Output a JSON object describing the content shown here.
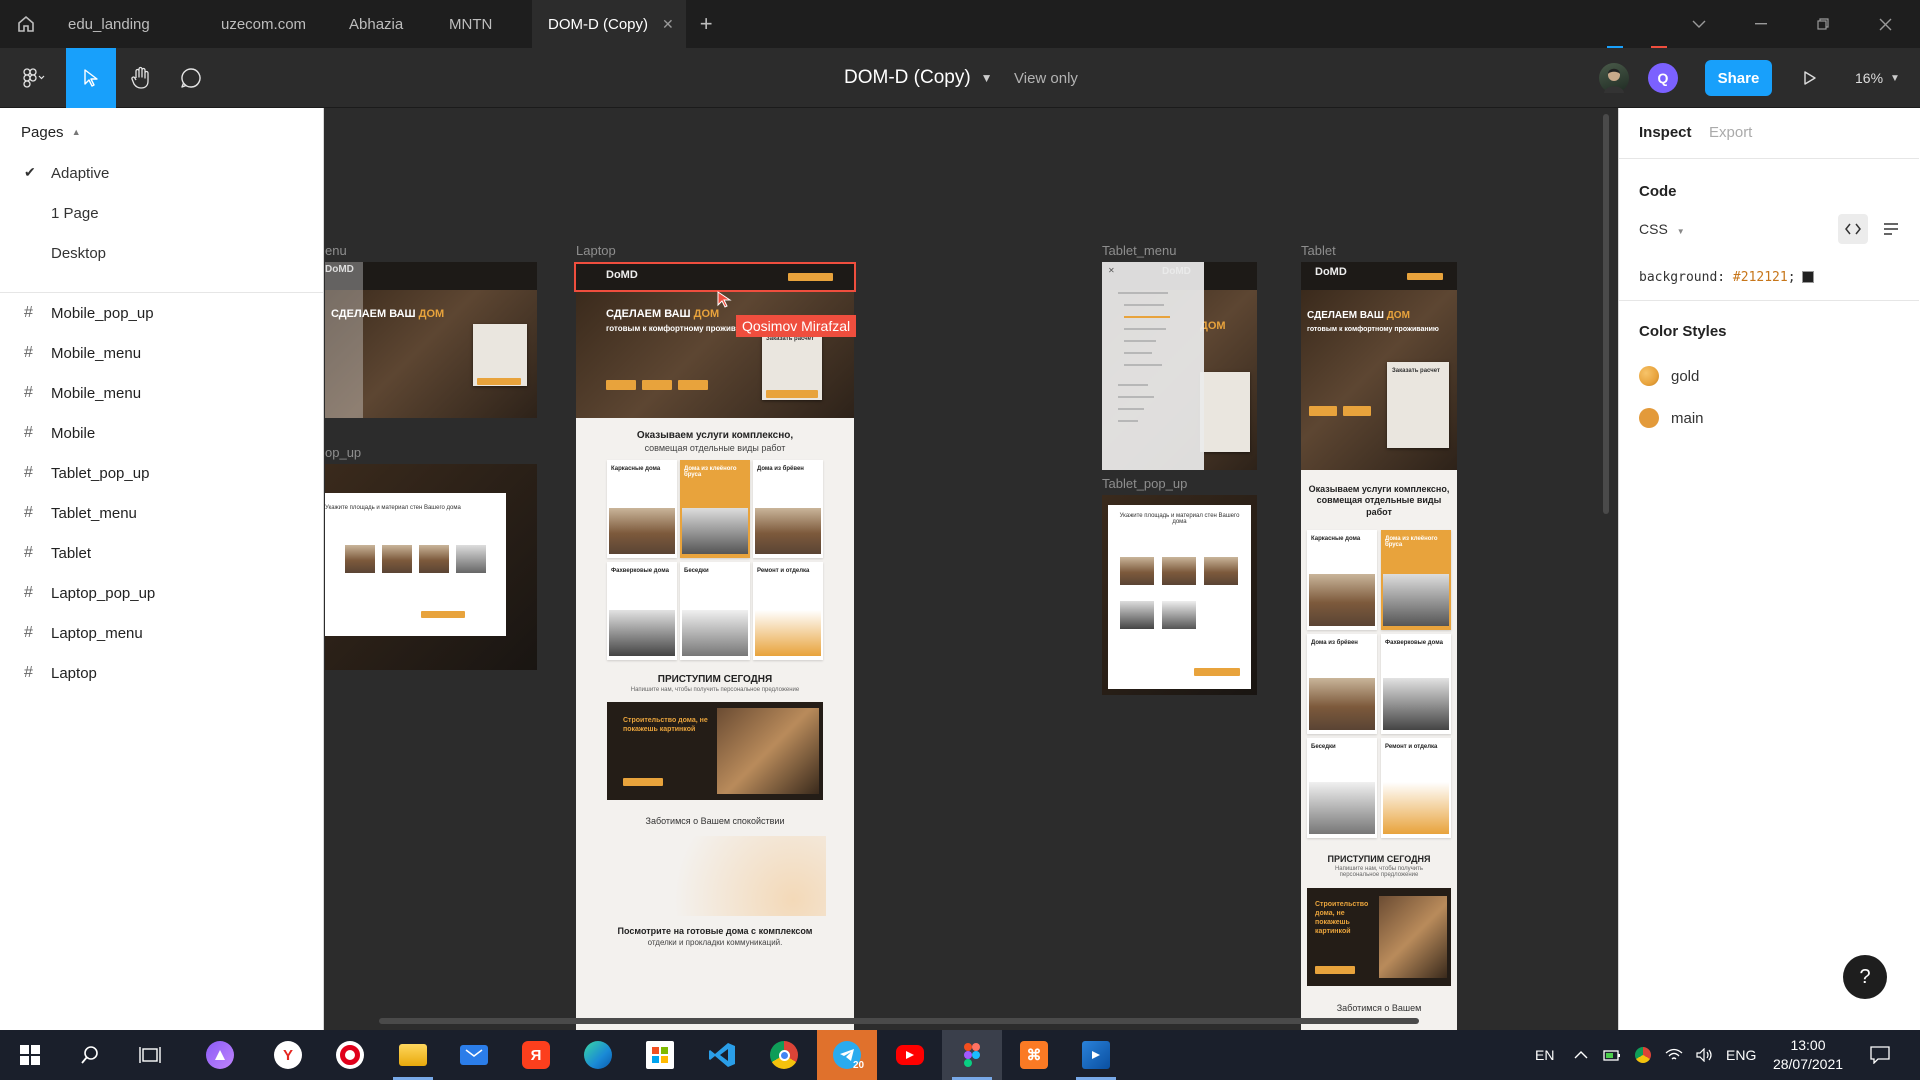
{
  "tabs": {
    "items": [
      {
        "label": "edu_landing"
      },
      {
        "label": "uzecom.com"
      },
      {
        "label": "Abhazia"
      },
      {
        "label": "MNTN"
      },
      {
        "label": "DOM-D (Copy)"
      }
    ],
    "close_glyph": "✕",
    "new_tab_glyph": "+"
  },
  "toolbar": {
    "document_title": "DOM-D (Copy)",
    "view_mode": "View only",
    "share_label": "Share",
    "avatar_initial": "Q",
    "zoom_level": "16%"
  },
  "pages_panel": {
    "heading": "Pages",
    "pages": [
      {
        "label": "Adaptive",
        "selected": true
      },
      {
        "label": "1 Page",
        "selected": false
      },
      {
        "label": "Desktop",
        "selected": false
      }
    ],
    "frames": [
      {
        "label": "Mobile_pop_up"
      },
      {
        "label": "Mobile_menu"
      },
      {
        "label": "Mobile_menu"
      },
      {
        "label": "Mobile"
      },
      {
        "label": "Tablet_pop_up"
      },
      {
        "label": "Tablet_menu"
      },
      {
        "label": "Tablet"
      },
      {
        "label": "Laptop_pop_up"
      },
      {
        "label": "Laptop_menu"
      },
      {
        "label": "Laptop"
      }
    ]
  },
  "canvas": {
    "frame_labels": {
      "laptop_menu": "enu",
      "laptop_popup": "op_up",
      "laptop": "Laptop",
      "tablet_menu": "Tablet_menu",
      "tablet_popup": "Tablet_pop_up",
      "tablet": "Tablet"
    },
    "cursor_user": "Qosimov Mirafzal",
    "logo": "DoMD",
    "laptop": {
      "hero_line1": "СДЕЛАЕМ ВАШ ",
      "hero_gold": "ДОМ",
      "hero_line2": "готовым к комфортному проживанию",
      "order_calc": "Заказать расчет",
      "services_title": "Оказываем услуги комплексно,",
      "services_sub": "совмещая отдельные виды работ",
      "cards": [
        {
          "label": "Каркасные дома"
        },
        {
          "label": "Дома из клеёного бруса"
        },
        {
          "label": "Дома из брёвен"
        },
        {
          "label": "Фахверковые дома"
        },
        {
          "label": "Беседки"
        },
        {
          "label": "Ремонт и отделка"
        }
      ],
      "start_title": "ПРИСТУПИМ СЕГОДНЯ",
      "start_sub": "Напишите нам, чтобы получить персональное предложение",
      "promo_title": "Строительство дома, не покажешь картинкой",
      "care_title": "Заботимся о Вашем спокойствии",
      "ready_title": "Посмотрите на готовые дома с комплексом",
      "ready_sub": "отделки и прокладки коммуникаций."
    },
    "tablet": {
      "hero_line1": "СДЕЛАЕМ ВАШ ",
      "hero_gold": "ДОМ",
      "hero_line2": "готовым к комфортному проживанию",
      "order_calc": "Заказать расчет",
      "services_title": "Оказываем услуги комплексно, совмещая отдельные виды работ",
      "cards": [
        {
          "label": "Каркасные дома"
        },
        {
          "label": "Дома из клеёного бруса"
        },
        {
          "label": "Дома из брёвен"
        },
        {
          "label": "Фахверковые дома"
        },
        {
          "label": "Беседки"
        },
        {
          "label": "Ремонт и отделка"
        }
      ],
      "start_title": "ПРИСТУПИМ СЕГОДНЯ",
      "start_sub": "Напишите нам, чтобы получить персональное предложение",
      "promo_title": "Строительство дома, не покажешь картинкой",
      "care_title": "Заботимся о Вашем"
    },
    "popup_question": "Укажите площадь и материал стен Вашего дома",
    "tablet_menu_hero": "ДОМ"
  },
  "inspect_panel": {
    "tab_inspect": "Inspect",
    "tab_export": "Export",
    "code_heading": "Code",
    "code_lang": "CSS",
    "code_property": "background: ",
    "code_value": "#212121",
    "code_end": ";",
    "color_styles_heading": "Color Styles",
    "color_styles": [
      {
        "name": "gold",
        "color": "#e8a33c"
      },
      {
        "name": "main",
        "color": "#e39a3a"
      }
    ],
    "help_label": "?"
  },
  "taskbar": {
    "lang_short": "EN",
    "lang_full": "ENG",
    "time": "13:00",
    "date": "28/07/2021",
    "telegram_badge": "20",
    "apps": [
      {
        "name": "windows-start-icon"
      },
      {
        "name": "search-icon"
      },
      {
        "name": "task-view-icon"
      },
      {
        "name": "alice-icon"
      },
      {
        "name": "yandex-browser-icon"
      },
      {
        "name": "opera-icon"
      },
      {
        "name": "file-explorer-icon"
      },
      {
        "name": "mail-icon"
      },
      {
        "name": "yandex-icon"
      },
      {
        "name": "edge-icon"
      },
      {
        "name": "store-icon"
      },
      {
        "name": "vscode-icon"
      },
      {
        "name": "chrome-icon"
      },
      {
        "name": "telegram-icon"
      },
      {
        "name": "youtube-icon"
      },
      {
        "name": "figma-icon"
      },
      {
        "name": "xampp-icon"
      },
      {
        "name": "media-icon"
      }
    ]
  },
  "colors": {
    "accent_blue": "#18a0fb",
    "collab_red": "#ef4e3e",
    "gold": "#e8a33c",
    "canvas_bg": "#2c2c2c"
  }
}
